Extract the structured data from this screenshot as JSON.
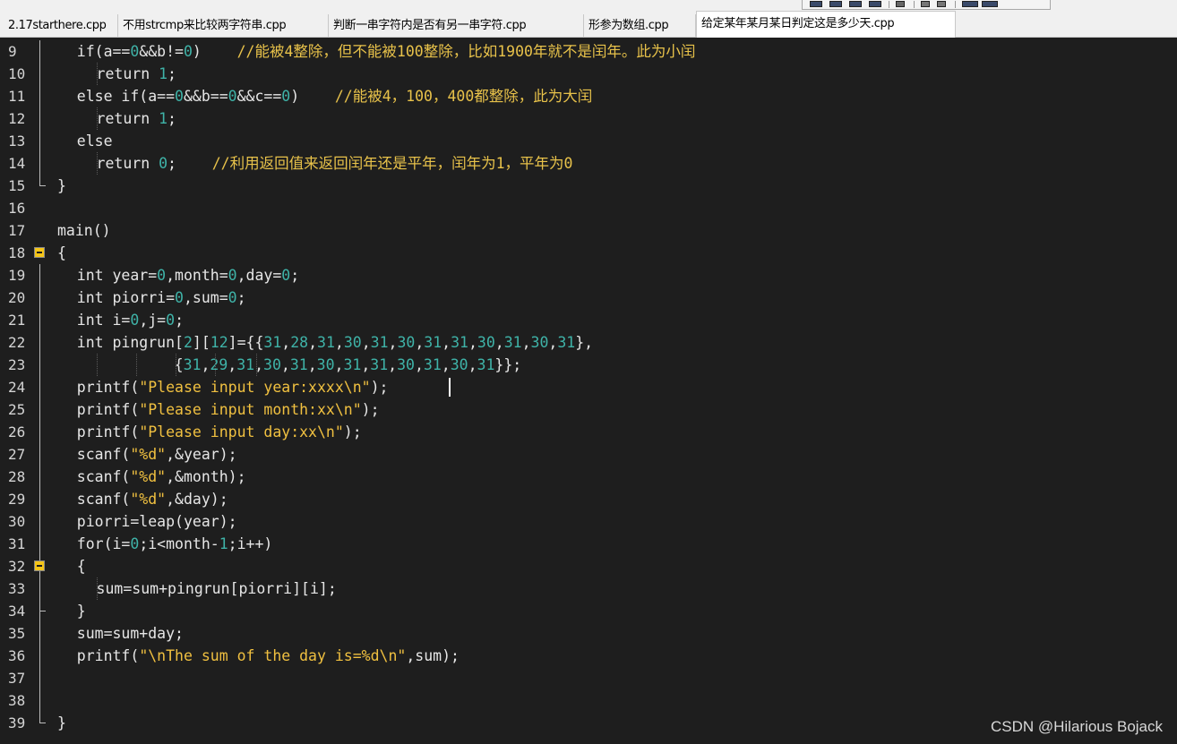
{
  "tabs": [
    {
      "label": "2.17starthere.cpp",
      "active": false
    },
    {
      "label": "不用strcmp来比较两字符串.cpp",
      "active": false
    },
    {
      "label": "判断一串字符内是否有另一串字符.cpp",
      "active": false
    },
    {
      "label": "形参为数组.cpp",
      "active": false
    },
    {
      "label": "给定某年某月某日判定这是多少天.cpp",
      "active": true
    }
  ],
  "lines": [
    {
      "num": "9",
      "indent": 2,
      "code": "if(a==<n>0</n>&&b!=<n>0</n>)    <c>//能被4整除，但不能被100整除，比如1900年就不是闰年。此为小闰</c>"
    },
    {
      "num": "10",
      "indent": 4,
      "code": "return <n>1</n>;"
    },
    {
      "num": "11",
      "indent": 2,
      "code": "else if(a==<n>0</n>&&b==<n>0</n>&&c==<n>0</n>)    <c>//能被4，100，400都整除，此为大闰</c>"
    },
    {
      "num": "12",
      "indent": 4,
      "code": "return <n>1</n>;"
    },
    {
      "num": "13",
      "indent": 2,
      "code": "else"
    },
    {
      "num": "14",
      "indent": 4,
      "code": "return <n>0</n>;    <c>//利用返回值来返回闰年还是平年，闰年为1，平年为0</c>"
    },
    {
      "num": "15",
      "indent": 0,
      "code": "}"
    },
    {
      "num": "16",
      "indent": 0,
      "code": ""
    },
    {
      "num": "17",
      "indent": 0,
      "code": "main()"
    },
    {
      "num": "18",
      "indent": 0,
      "code": "{"
    },
    {
      "num": "19",
      "indent": 2,
      "code": "int year=<n>0</n>,month=<n>0</n>,day=<n>0</n>;"
    },
    {
      "num": "20",
      "indent": 2,
      "code": "int piorri=<n>0</n>,sum=<n>0</n>;"
    },
    {
      "num": "21",
      "indent": 2,
      "code": "int i=<n>0</n>,j=<n>0</n>;"
    },
    {
      "num": "22",
      "indent": 2,
      "code": "int pingrun[<n>2</n>][<n>12</n>]={{<n>31</n>,<n>28</n>,<n>31</n>,<n>30</n>,<n>31</n>,<n>30</n>,<n>31</n>,<n>31</n>,<n>30</n>,<n>31</n>,<n>30</n>,<n>31</n>},"
    },
    {
      "num": "23",
      "indent": 12,
      "code": "{<n>31</n>,<n>29</n>,<n>31</n>,<n>30</n>,<n>31</n>,<n>30</n>,<n>31</n>,<n>31</n>,<n>30</n>,<n>31</n>,<n>30</n>,<n>31</n>}};"
    },
    {
      "num": "24",
      "indent": 2,
      "code": "printf(<s>\"Please input year:xxxx\\n\"</s>);"
    },
    {
      "num": "25",
      "indent": 2,
      "code": "printf(<s>\"Please input month:xx\\n\"</s>);"
    },
    {
      "num": "26",
      "indent": 2,
      "code": "printf(<s>\"Please input day:xx\\n\"</s>);"
    },
    {
      "num": "27",
      "indent": 2,
      "code": "scanf(<s>\"%d\"</s>,&year);"
    },
    {
      "num": "28",
      "indent": 2,
      "code": "scanf(<s>\"%d\"</s>,&month);"
    },
    {
      "num": "29",
      "indent": 2,
      "code": "scanf(<s>\"%d\"</s>,&day);"
    },
    {
      "num": "30",
      "indent": 2,
      "code": "piorri=leap(year);"
    },
    {
      "num": "31",
      "indent": 2,
      "code": "for(i=<n>0</n>;i<month-<n>1</n>;i++)"
    },
    {
      "num": "32",
      "indent": 2,
      "code": "{"
    },
    {
      "num": "33",
      "indent": 4,
      "code": "sum=sum+pingrun[piorri][i];"
    },
    {
      "num": "34",
      "indent": 2,
      "code": "}"
    },
    {
      "num": "35",
      "indent": 2,
      "code": "sum=sum+day;"
    },
    {
      "num": "36",
      "indent": 2,
      "code": "printf(<s>\"\\nThe sum of the day is=%d\\n\"</s>,sum);"
    },
    {
      "num": "37",
      "indent": 0,
      "code": ""
    },
    {
      "num": "38",
      "indent": 0,
      "code": ""
    },
    {
      "num": "39",
      "indent": 0,
      "code": "}"
    }
  ],
  "watermark": "CSDN @Hilarious Bojack",
  "colors": {
    "background": "#1e1e1e",
    "number": "#3fb3a8",
    "string": "#f0c040",
    "comment": "#e8c24a",
    "text": "#e6e6e6",
    "fold_marker": "#f5c518"
  }
}
